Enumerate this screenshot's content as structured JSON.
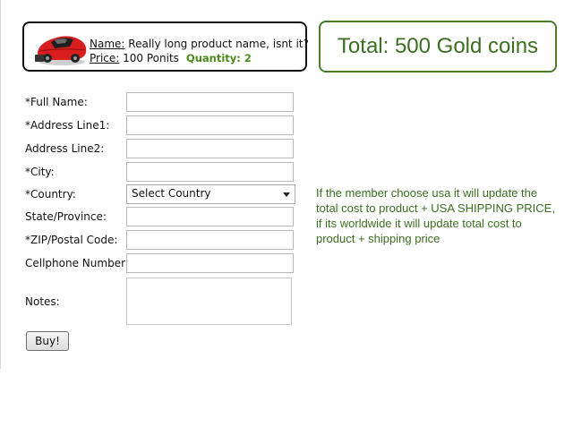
{
  "product": {
    "name_label": "Name:",
    "name_value": "Really long product name, isnt it?",
    "price_label": "Price:",
    "price_value": "100 Ponits",
    "quantity": "Quantity: 2",
    "image_icon": "red-sports-car-mouse"
  },
  "total": {
    "text": "Total: 500 Gold coins"
  },
  "form": {
    "full_name_label": "*Full Name:",
    "address1_label": "*Address Line1:",
    "address2_label": "Address Line2:",
    "city_label": "*City:",
    "country_label": "*Country:",
    "country_selected": "Select Country",
    "state_label": "State/Province:",
    "zip_label": "*ZIP/Postal Code:",
    "cellphone_label": "Cellphone Number:",
    "notes_label": "Notes:",
    "buy_label": "Buy!"
  },
  "shipping_note": "If the member choose usa it will update the total cost to product + USA SHIPPING PRICE, if its worldwide it will update total cost to product + shipping price",
  "colors": {
    "accent_green": "#3d6e22",
    "quantity_green": "#4a8a1c",
    "car_red": "#d81e1e"
  }
}
